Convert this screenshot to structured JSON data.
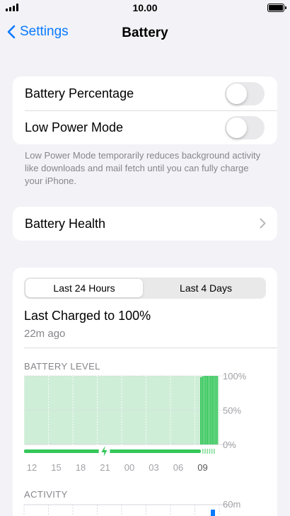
{
  "status_bar": {
    "time": "10.00"
  },
  "nav": {
    "back_label": "Settings",
    "title": "Battery"
  },
  "settings": {
    "battery_percentage": {
      "label": "Battery Percentage",
      "enabled": false
    },
    "low_power_mode": {
      "label": "Low Power Mode",
      "enabled": false
    },
    "footnote": "Low Power Mode temporarily reduces background activity like downloads and mail fetch until you can fully charge your iPhone."
  },
  "battery_health": {
    "label": "Battery Health"
  },
  "usage": {
    "tabs": [
      {
        "label": "Last 24 Hours",
        "selected": true
      },
      {
        "label": "Last 4 Days",
        "selected": false
      }
    ],
    "last_charged": "Last Charged to 100%",
    "charged_ago": "22m ago",
    "battery_level_label": "BATTERY LEVEL",
    "activity_label": "ACTIVITY"
  },
  "colors": {
    "accent": "#0a7aff",
    "battery_green": "#34c759",
    "battery_area": "#cfeed8"
  },
  "chart_data": [
    {
      "type": "bar",
      "title": "BATTERY LEVEL",
      "x_ticks": [
        "12",
        "15",
        "18",
        "21",
        "00",
        "03",
        "06",
        "09"
      ],
      "y_ticks": [
        "100%",
        "50%",
        "0%"
      ],
      "ylim": [
        0,
        100
      ],
      "charging_marker_at": "21",
      "values_at_end": [
        98,
        99,
        100,
        100,
        100,
        100,
        100,
        100,
        100,
        100,
        100
      ]
    },
    {
      "type": "bar",
      "title": "ACTIVITY",
      "y_ticks": [
        "60m"
      ],
      "ylim": [
        0,
        60
      ]
    }
  ]
}
